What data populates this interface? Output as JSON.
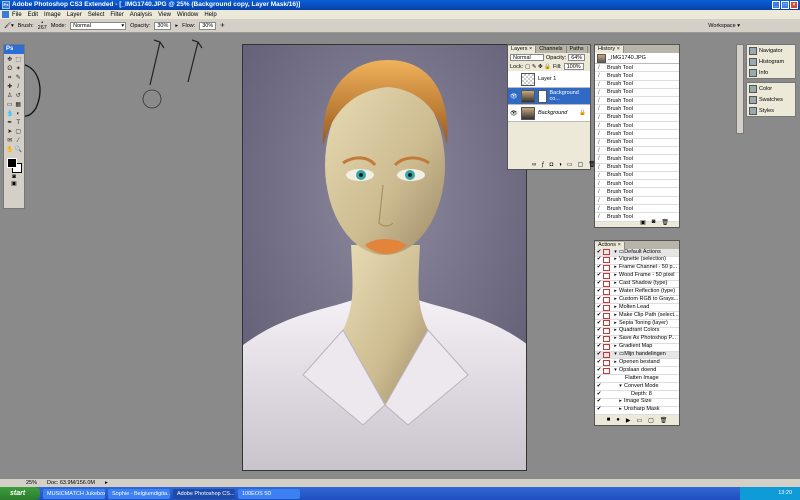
{
  "window": {
    "title": "Adobe Photoshop CS3 Extended - [_IMG1740.JPG @ 25% (Background copy, Layer Mask/16)]"
  },
  "menu": [
    "File",
    "Edit",
    "Image",
    "Layer",
    "Select",
    "Filter",
    "Analysis",
    "View",
    "Window",
    "Help"
  ],
  "options": {
    "brush_label": "Brush:",
    "brush_size": "267",
    "mode_label": "Mode:",
    "mode_value": "Normal",
    "opacity_label": "Opacity:",
    "opacity_value": "30%",
    "flow_label": "Flow:",
    "flow_value": "30%",
    "workspace": "Workspace ▾"
  },
  "toolbox": {
    "logo": "Ps"
  },
  "layers_panel": {
    "tabs": [
      "Layers ×",
      "Channels",
      "Paths"
    ],
    "blend": "Normal",
    "opacity_label": "Opacity:",
    "opacity": "64%",
    "lock_label": "Lock:",
    "fill_label": "Fill:",
    "fill": "100%",
    "layers": [
      {
        "name": "Layer 1"
      },
      {
        "name": "Background co..."
      },
      {
        "name": "Background"
      }
    ]
  },
  "history_panel": {
    "tab": "History ×",
    "snapshot": "_IMG1740.JPG",
    "items": [
      "Brush Tool",
      "Brush Tool",
      "Brush Tool",
      "Brush Tool",
      "Brush Tool",
      "Brush Tool",
      "Brush Tool",
      "Brush Tool",
      "Brush Tool",
      "Brush Tool",
      "Brush Tool",
      "Brush Tool",
      "Brush Tool",
      "Brush Tool",
      "Brush Tool",
      "Brush Tool",
      "Brush Tool",
      "Brush Tool",
      "Brush Tool"
    ]
  },
  "actions_panel": {
    "tab": "Actions ×",
    "items": [
      {
        "label": "Default Actions",
        "kind": "set"
      },
      {
        "label": "Vignette (selection)"
      },
      {
        "label": "Frame Channel - 50 p..."
      },
      {
        "label": "Wood Frame - 50 pixel"
      },
      {
        "label": "Cast Shadow (type)"
      },
      {
        "label": "Water Reflection (type)"
      },
      {
        "label": "Custom RGB to Grays..."
      },
      {
        "label": "Molten Lead"
      },
      {
        "label": "Make Clip Path (select..."
      },
      {
        "label": "Sepia Toning (layer)"
      },
      {
        "label": "Quadrant Colors"
      },
      {
        "label": "Save As Photoshop P..."
      },
      {
        "label": "Gradient Map"
      },
      {
        "label": "Mijn handelingen",
        "kind": "set"
      },
      {
        "label": "Openen bestand"
      },
      {
        "label": "Opslaan doend"
      },
      {
        "label": "Flatten Image"
      },
      {
        "label": "Convert Mode"
      },
      {
        "label": "Depth: 8"
      },
      {
        "label": "Image Size"
      },
      {
        "label": "Unsharp Mask"
      }
    ]
  },
  "dock": [
    {
      "items": [
        "Navigator",
        "Histogram",
        "Info"
      ]
    },
    {
      "items": [
        "Color",
        "Swatches",
        "Styles"
      ]
    }
  ],
  "status": {
    "zoom": "25%",
    "doc": "Doc: 63.9M/156.0M"
  },
  "taskbar": {
    "start": "start",
    "buttons": [
      "MUSICMATCH Jukebox",
      "Sophie - Belgiumdigita...",
      "Adobe Photoshop CS...",
      "100EOS 5D"
    ],
    "clock": "13:20"
  }
}
